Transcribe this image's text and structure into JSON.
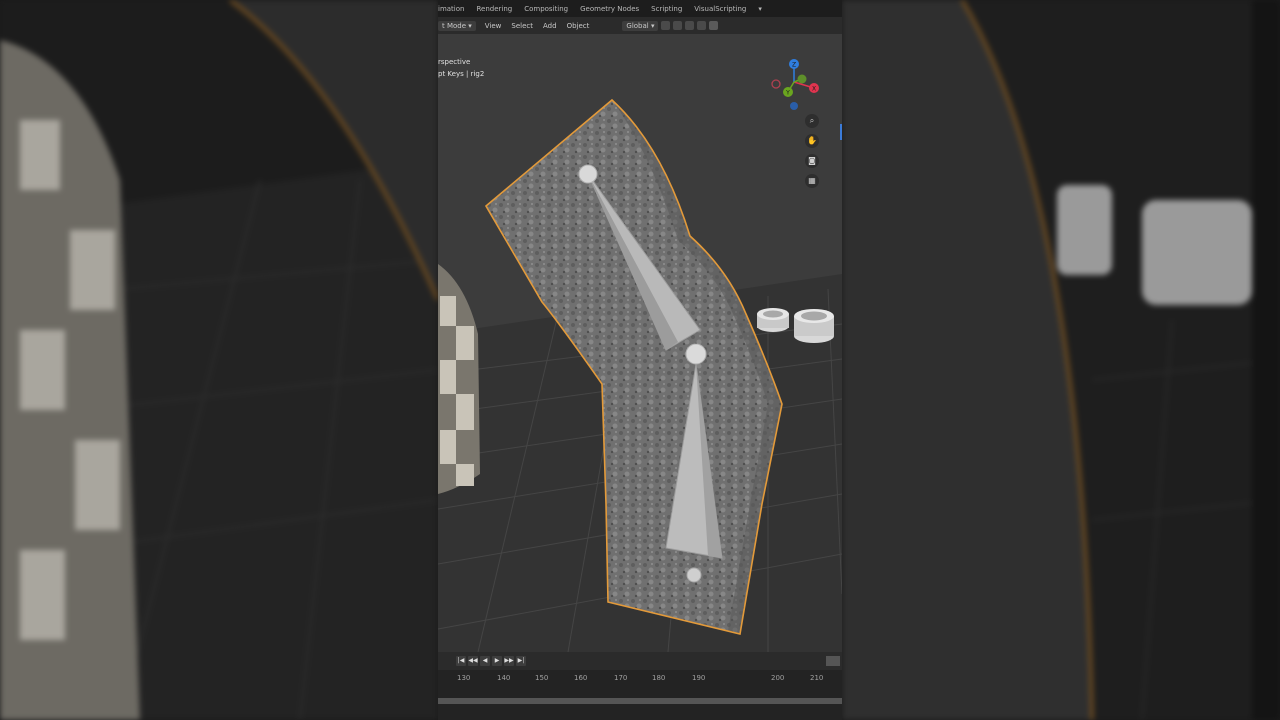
{
  "topbar": {
    "workspaces": [
      "imation",
      "Rendering",
      "Compositing",
      "Geometry Nodes",
      "Scripting",
      "VisualScripting",
      "▾"
    ]
  },
  "toolbar": {
    "mode": "t Mode ▾",
    "menus": [
      "View",
      "Select",
      "Add",
      "Object"
    ],
    "transform_orientation": "Global ▾"
  },
  "viewport": {
    "view_label": "rspective",
    "object_label": "pt Keys | rig2"
  },
  "navigation": {
    "axis_x": "X",
    "axis_y": "Y",
    "axis_z": "Z",
    "buttons": [
      "zoom-icon",
      "hand-icon",
      "camera-icon",
      "grid-icon"
    ]
  },
  "timeline": {
    "frames": [
      "130",
      "140",
      "150",
      "160",
      "170",
      "180",
      "190",
      "200",
      "210"
    ],
    "controls": [
      "|◀",
      "◀◀",
      "◀",
      "▶",
      "▶▶",
      "▶|"
    ]
  },
  "colors": {
    "selection_outline": "#e39a3a",
    "axis_x": "#e0344f",
    "axis_y": "#6aa61f",
    "axis_z": "#2f7ee0"
  }
}
